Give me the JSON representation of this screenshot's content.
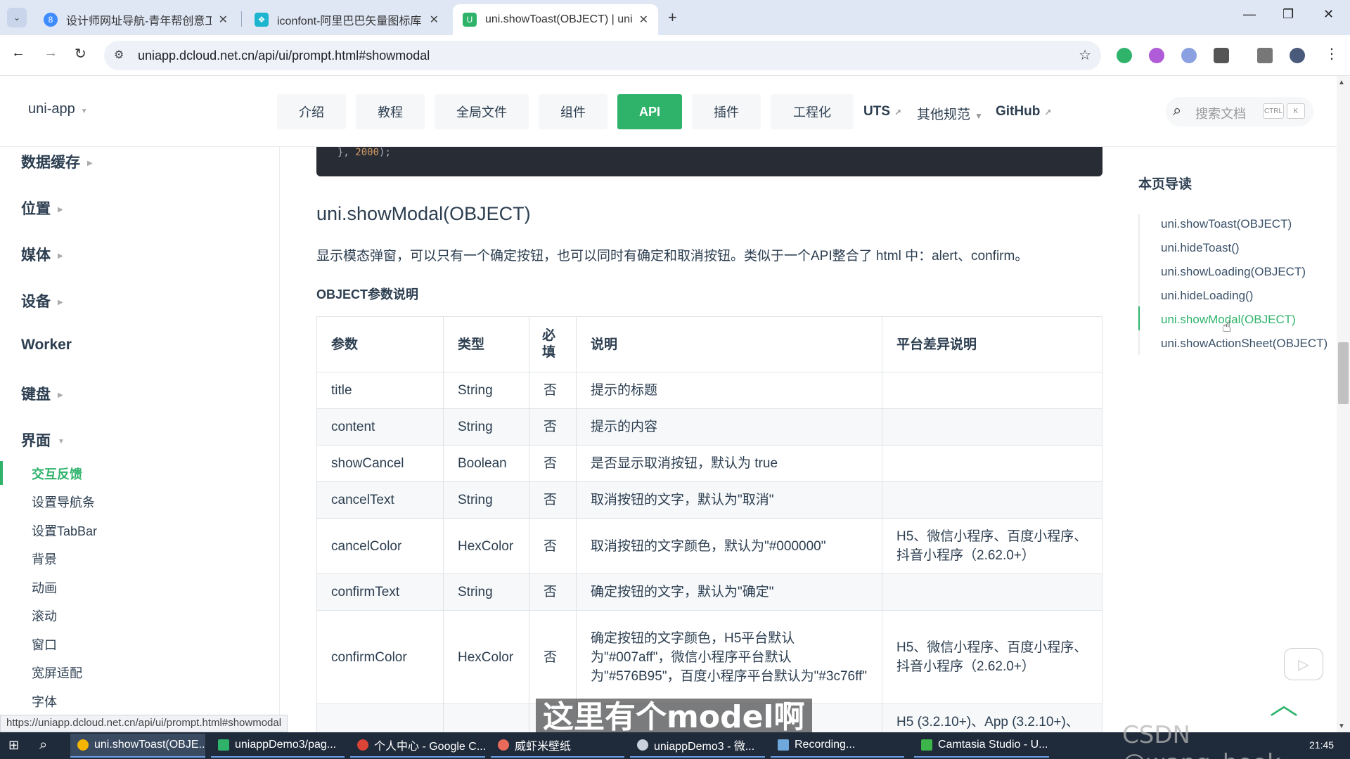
{
  "browser": {
    "tabs": [
      {
        "title": "设计师网址导航-青年帮创意工",
        "icon": "site-8-icon"
      },
      {
        "title": "iconfont-阿里巴巴矢量图标库",
        "icon": "iconfont-icon"
      },
      {
        "title": "uni.showToast(OBJECT) | uni-",
        "icon": "uniapp-icon"
      }
    ],
    "url": "uniapp.dcloud.net.cn/api/ui/prompt.html#showmodal",
    "status_url": "https://uniapp.dcloud.net.cn/api/ui/prompt.html#showmodal"
  },
  "header": {
    "brand": "uni-app",
    "nav": [
      {
        "label": "介绍"
      },
      {
        "label": "教程"
      },
      {
        "label": "全局文件"
      },
      {
        "label": "组件"
      },
      {
        "label": "API"
      },
      {
        "label": "插件"
      },
      {
        "label": "工程化"
      }
    ],
    "uts": "UTS",
    "other": "其他规范",
    "github": "GitHub",
    "search_placeholder": "搜索文档",
    "kbd_ctrl": "CTRL",
    "kbd_k": "K"
  },
  "sidebar": {
    "groups": [
      "数据缓存",
      "位置",
      "媒体",
      "设备",
      "Worker",
      "键盘",
      "界面"
    ],
    "items": [
      "交互反馈",
      "设置导航条",
      "设置TabBar",
      "背景",
      "动画",
      "滚动",
      "窗口",
      "宽屏适配",
      "字体"
    ]
  },
  "main": {
    "code_tail": "}, ",
    "code_num": "2000",
    "code_end": ");",
    "title": "uni.showModal(OBJECT)",
    "description": "显示模态弹窗，可以只有一个确定按钮，也可以同时有确定和取消按钮。类似于一个API整合了 html 中：alert、confirm。",
    "section": "OBJECT参数说明",
    "table": {
      "headers": [
        "参数",
        "类型",
        "必填",
        "说明",
        "平台差异说明"
      ],
      "rows": [
        [
          "title",
          "String",
          "否",
          "提示的标题",
          ""
        ],
        [
          "content",
          "String",
          "否",
          "提示的内容",
          ""
        ],
        [
          "showCancel",
          "Boolean",
          "否",
          "是否显示取消按钮，默认为 true",
          ""
        ],
        [
          "cancelText",
          "String",
          "否",
          "取消按钮的文字，默认为\"取消\"",
          ""
        ],
        [
          "cancelColor",
          "HexColor",
          "否",
          "取消按钮的文字颜色，默认为\"#000000\"",
          "H5、微信小程序、百度小程序、抖音小程序（2.62.0+）"
        ],
        [
          "confirmText",
          "String",
          "否",
          "确定按钮的文字，默认为\"确定\"",
          ""
        ],
        [
          "confirmColor",
          "HexColor",
          "否",
          "确定按钮的文字颜色，H5平台默认为\"#007aff\"，微信小程序平台默认为\"#576B95\"，百度小程序平台默认为\"#3c76ff\"",
          "H5、微信小程序、百度小程序、抖音小程序（2.62.0+）"
        ],
        [
          "",
          "",
          "",
          "",
          "H5 (3.2.10+)、App (3.2.10+)、"
        ]
      ]
    }
  },
  "toc": {
    "title": "本页导读",
    "items": [
      "uni.showToast(OBJECT)",
      "uni.hideToast()",
      "uni.showLoading(OBJECT)",
      "uni.hideLoading()",
      "uni.showModal(OBJECT)",
      "uni.showActionSheet(OBJECT)"
    ]
  },
  "overlay": {
    "subtitle": "这里有个model啊",
    "watermark": "CSDN @wang_book"
  },
  "taskbar": {
    "tasks": [
      "uni.showToast(OBJE...",
      "uniappDemo3/pag...",
      "个人中心 - Google C...",
      "威虾米壁纸",
      "uniappDemo3 - 微...",
      "Recording...",
      "Camtasia Studio - U..."
    ],
    "time": "21:45"
  },
  "colors": {
    "accent": "#2fb36b",
    "code_bg": "#282c34"
  }
}
